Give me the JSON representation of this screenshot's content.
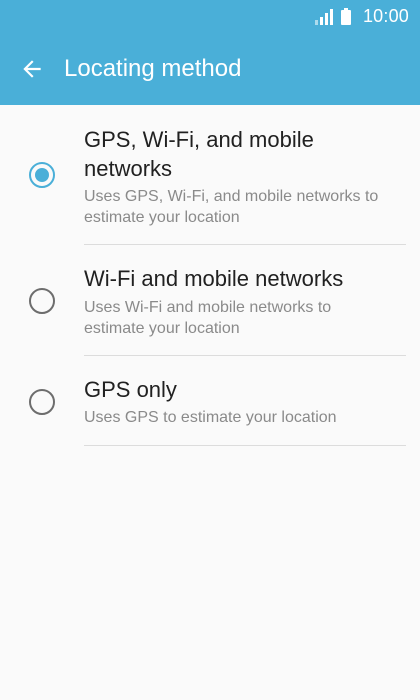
{
  "status_bar": {
    "time": "10:00",
    "icons": [
      "signal-icon",
      "battery-icon"
    ]
  },
  "app_bar": {
    "title": "Locating method",
    "back_icon": "arrow-left-icon"
  },
  "colors": {
    "accent": "#4aafd8",
    "background": "#fafafa",
    "primary_text": "#212121",
    "secondary_text": "#8a8a8a",
    "divider": "#dcdcdc"
  },
  "options": [
    {
      "title": "GPS, Wi-Fi, and mobile networks",
      "description": "Uses GPS, Wi-Fi, and mobile networks to estimate your location",
      "selected": true
    },
    {
      "title": "Wi-Fi and mobile networks",
      "description": "Uses Wi-Fi and mobile networks to estimate your location",
      "selected": false
    },
    {
      "title": "GPS only",
      "description": "Uses GPS to estimate your location",
      "selected": false
    }
  ]
}
